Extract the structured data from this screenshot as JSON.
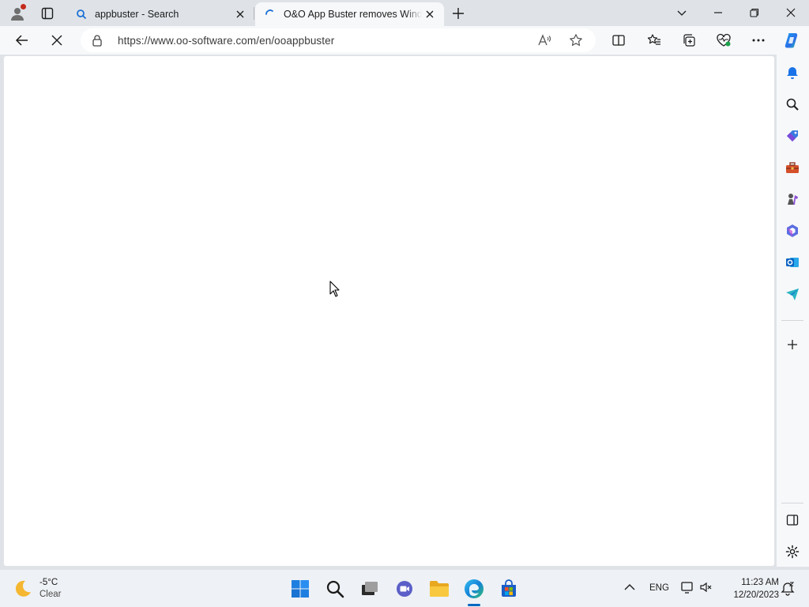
{
  "browser": {
    "tabs": [
      {
        "title": "appbuster - Search",
        "state": "inactive"
      },
      {
        "title": "O&O App Buster removes Windows",
        "state": "active",
        "loading": true
      }
    ],
    "address_bar": {
      "url": "https://www.oo-software.com/en/ooappbuster"
    }
  },
  "taskbar": {
    "weather": {
      "temperature": "-5°C",
      "condition": "Clear"
    },
    "tray": {
      "language": "ENG"
    },
    "clock": {
      "time": "11:23 AM",
      "date": "12/20/2023"
    }
  },
  "colors": {
    "accent": "#0067c0",
    "chrome_bg": "#dfe3e8",
    "toolbar_bg": "#f7f8fa"
  }
}
